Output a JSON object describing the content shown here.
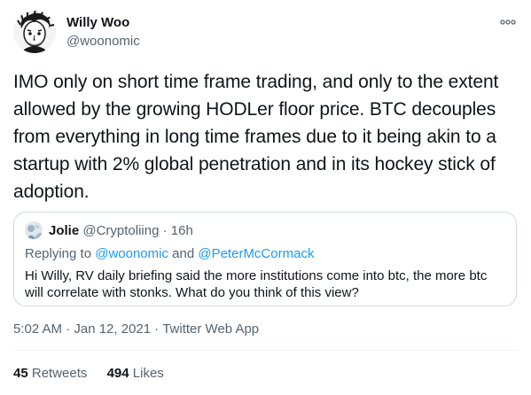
{
  "tweet": {
    "author_name": "Willy Woo",
    "author_handle": "@woonomic",
    "text": "IMO only on short time frame trading, and only to the extent allowed by the growing HODLer floor price. BTC decouples from everything in long time frames due to it being akin to a startup with 2% global penetration and in its hockey stick of adoption.",
    "timestamp": "5:02 AM · Jan 12, 2021",
    "separator": "·",
    "source": "Twitter Web App",
    "retweets_count": "45",
    "retweets_label": "Retweets",
    "likes_count": "494",
    "likes_label": "Likes",
    "more_icon": "more-dots-icon"
  },
  "quoted": {
    "author_name": "Jolie",
    "author_handle": "@Cryptoliing",
    "separator": "·",
    "time_ago": "16h",
    "replying_label": "Replying to",
    "reply_mention_1": "@woonomic",
    "reply_and": "and",
    "reply_mention_2": "@PeterMcCormack",
    "text": "Hi Willy, RV daily briefing said the more institutions come into btc, the more btc will correlate with stonks. What do you think of this view?"
  },
  "colors": {
    "text_primary": "#0f1419",
    "text_secondary": "#536471",
    "link": "#1d9bf0",
    "border": "#cfd9de"
  }
}
